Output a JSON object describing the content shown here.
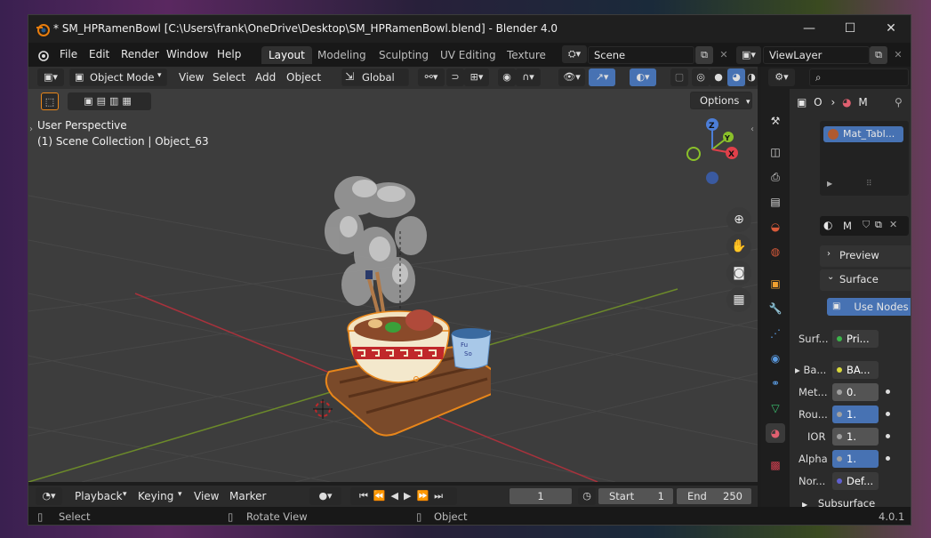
{
  "window": {
    "title": "* SM_HPRamenBowl [C:\\Users\\frank\\OneDrive\\Desktop\\SM_HPRamenBowl.blend] - Blender 4.0",
    "minimize": "—",
    "maximize": "☐",
    "close": "✕"
  },
  "menu": {
    "items": [
      "File",
      "Edit",
      "Render",
      "Window",
      "Help"
    ],
    "workspaces": [
      "Layout",
      "Modeling",
      "Sculpting",
      "UV Editing",
      "Texture Pa"
    ],
    "scene": "Scene",
    "view_layer": "ViewLayer"
  },
  "viewport_header": {
    "mode": "Object Mode",
    "menus": [
      "View",
      "Select",
      "Add",
      "Object"
    ],
    "orientation": "Global",
    "options": "Options"
  },
  "viewport": {
    "perspective": "User Perspective",
    "collection": "(1) Scene Collection | Object_63",
    "axes": [
      "Z",
      "Y",
      "X"
    ],
    "label_text": "Fu\nSo"
  },
  "timeline": {
    "menus": [
      "Playback",
      "Keying",
      "View",
      "Marker"
    ],
    "current_frame": "1",
    "start_label": "Start",
    "start": "1",
    "end_label": "End",
    "end": "250"
  },
  "status": {
    "select": "Select",
    "rotate": "Rotate View",
    "object": "Object",
    "version": "4.0.1"
  },
  "properties": {
    "breadcrumb_obj": "O",
    "breadcrumb_mat": "M",
    "slot_name": "Mat_Tabl...",
    "material_name": "M",
    "preview": "Preview",
    "surface": "Surface",
    "use_nodes": "Use Nodes",
    "rows": [
      {
        "label": "Surf...",
        "value": "Pri...",
        "socket": "#3cb34a"
      },
      {
        "label": "Ba...",
        "value": "BA...",
        "socket": "#d8d83a"
      },
      {
        "label": "Met...",
        "value": "0.",
        "socket": "#a0a0a0"
      },
      {
        "label": "Rou...",
        "value": "1.",
        "socket": "#a0a0a0"
      },
      {
        "label": "IOR",
        "value": "1.",
        "socket": "#a0a0a0"
      },
      {
        "label": "Alpha",
        "value": "1.",
        "socket": "#a0a0a0"
      },
      {
        "label": "Nor...",
        "value": "Def...",
        "socket": "#6060d0"
      }
    ],
    "subsurface": "Subsurface"
  },
  "colors": {
    "accent": "#4772b3",
    "selection": "#e8861a",
    "viewport_bg": "#3d3d3d"
  }
}
